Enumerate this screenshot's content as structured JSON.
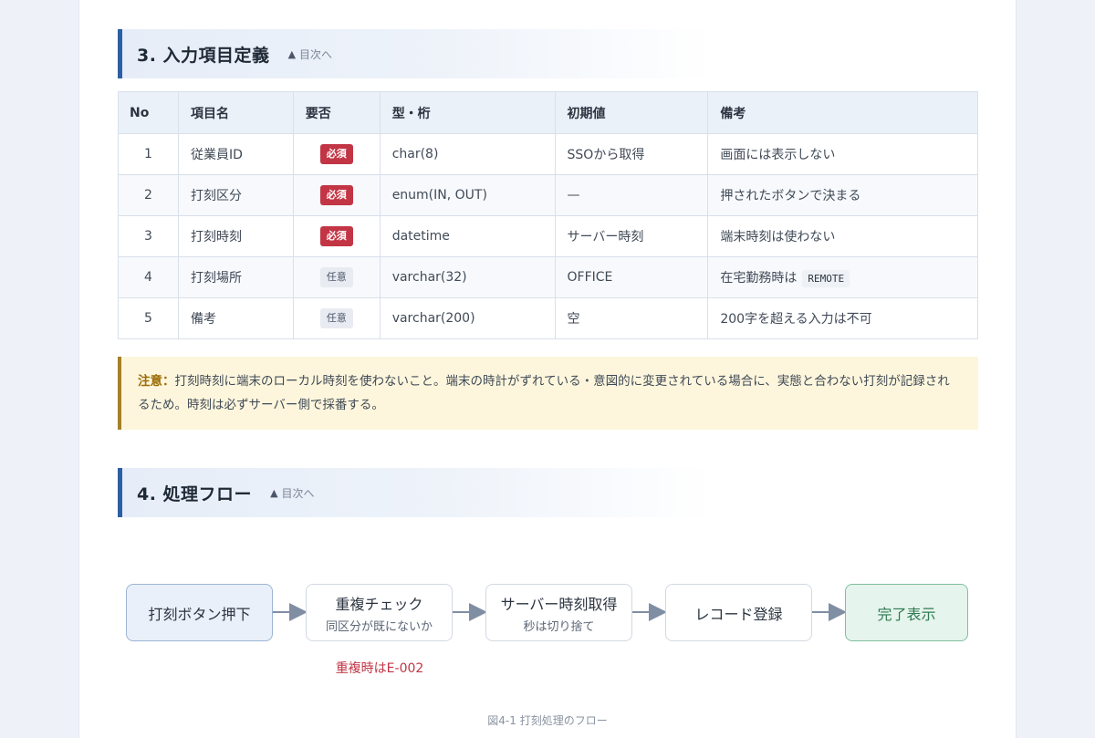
{
  "section3": {
    "title": "3. 入力項目定義",
    "toc_arrow": "▲",
    "toc_label": "目次へ",
    "table": {
      "headers": [
        "No",
        "項目名",
        "要否",
        "型・桁",
        "初期値",
        "備考"
      ],
      "rows": [
        {
          "no": "1",
          "name": "従業員ID",
          "req": "必須",
          "req_kind": "must",
          "type": "char(8)",
          "init": "SSOから取得",
          "note": "画面には表示しない",
          "code": ""
        },
        {
          "no": "2",
          "name": "打刻区分",
          "req": "必須",
          "req_kind": "must",
          "type": "enum(IN, OUT)",
          "init": "—",
          "note": "押されたボタンで決まる",
          "code": ""
        },
        {
          "no": "3",
          "name": "打刻時刻",
          "req": "必須",
          "req_kind": "must",
          "type": "datetime",
          "init": "サーバー時刻",
          "note": "端末時刻は使わない",
          "code": ""
        },
        {
          "no": "4",
          "name": "打刻場所",
          "req": "任意",
          "req_kind": "opt",
          "type": "varchar(32)",
          "init": "OFFICE",
          "note": "在宅勤務時は",
          "code": "REMOTE"
        },
        {
          "no": "5",
          "name": "備考",
          "req": "任意",
          "req_kind": "opt",
          "type": "varchar(200)",
          "init": "空",
          "note": "200字を超える入力は不可",
          "code": ""
        }
      ]
    },
    "note_label": "注意：",
    "note_text": "打刻時刻に端末のローカル時刻を使わないこと。端末の時計がずれている・意図的に変更されている場合に、実態と合わない打刻が記録されるため。時刻は必ずサーバー側で採番する。"
  },
  "section4": {
    "title": "4. 処理フロー",
    "toc_arrow": "▲",
    "toc_label": "目次へ",
    "flow": {
      "step1": {
        "main": "打刻ボタン押下"
      },
      "step2": {
        "main": "重複チェック",
        "sub": "同区分が既にないか"
      },
      "step3": {
        "main": "サーバー時刻取得",
        "sub": "秒は切り捨て"
      },
      "step4": {
        "main": "レコード登録"
      },
      "step5": {
        "main": "完了表示"
      },
      "duplicate_note": "重複時はE-002"
    },
    "caption": "図4-1 打刻処理のフロー"
  },
  "colors": {
    "accent": "#2d5fa3",
    "must_badge": "#c23545",
    "note_border": "#a4802a",
    "note_bg": "#fdf6dc",
    "end_box": "#e5f4ec"
  }
}
